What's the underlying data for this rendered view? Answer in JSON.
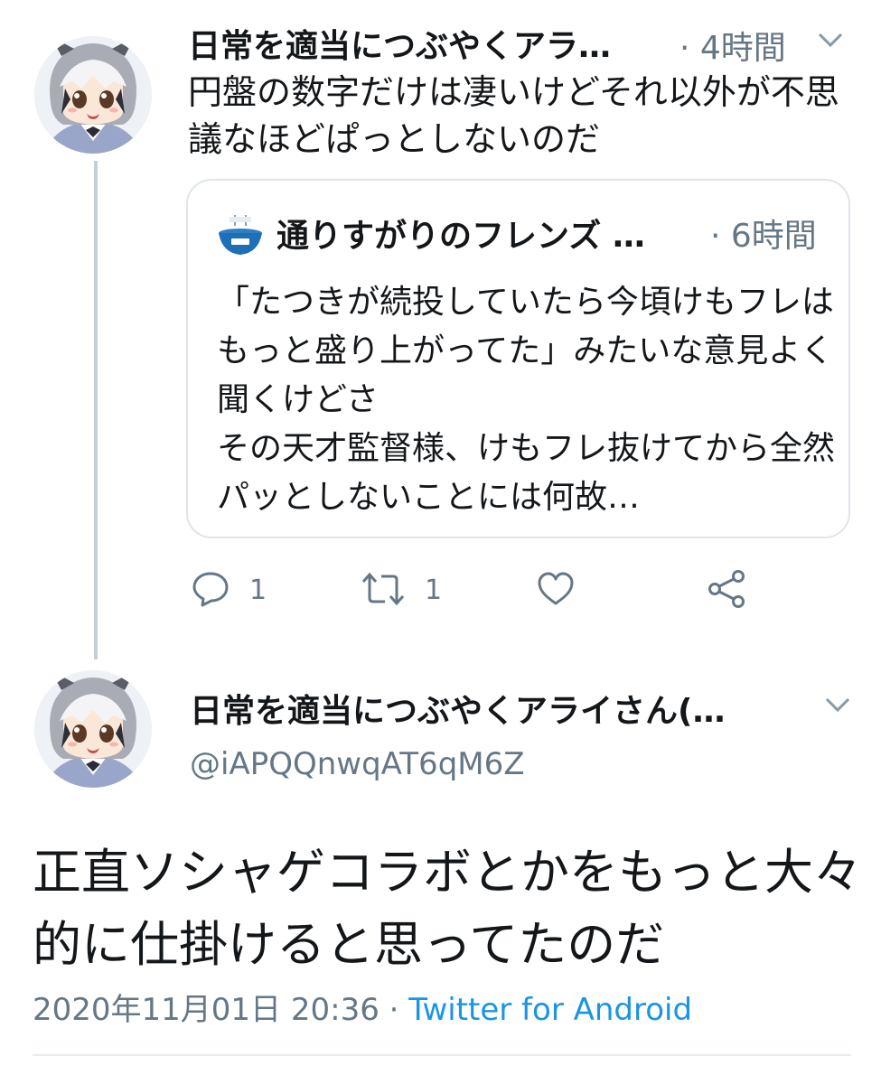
{
  "thread": {
    "tweet": {
      "author_name": "日常を適当につぶやくアラ…",
      "separator": "·",
      "time": "4時間",
      "text": "円盤の数字だけは凄いけどそれ以外が不思議なほどぱっとしないのだ",
      "actions": {
        "reply_count": "1",
        "retweet_count": "1"
      }
    },
    "quoted": {
      "author_name": "通りすがりのフレンズ …",
      "separator": "·",
      "time": "6時間",
      "text": "「たつきが続投していたら今頃けもフレはもっと盛り上がってた」みたいな意見よく聞くけどさ\nその天才監督様、けもフレ抜けてから全然パッとしないことには何故…"
    }
  },
  "main_tweet": {
    "author_name": "日常を適当につぶやくアライさん(…",
    "handle": "@iAPQQnwqAT6qM6Z",
    "text": "正直ソシャゲコラボとかをもっと大々的に仕掛けると思ってたのだ",
    "date": "2020年11月01日 20:36",
    "separator": "·",
    "source": "Twitter for Android"
  },
  "icons": [
    "avatar-araisan",
    "chevron-down-icon",
    "bowl-avatar-icon",
    "reply-icon",
    "retweet-icon",
    "like-icon",
    "share-icon"
  ],
  "colors": {
    "text": "#14171a",
    "muted": "#657786",
    "link": "#1b95e0",
    "border": "#dfe5ea",
    "thread_line": "#c4cfd6"
  }
}
